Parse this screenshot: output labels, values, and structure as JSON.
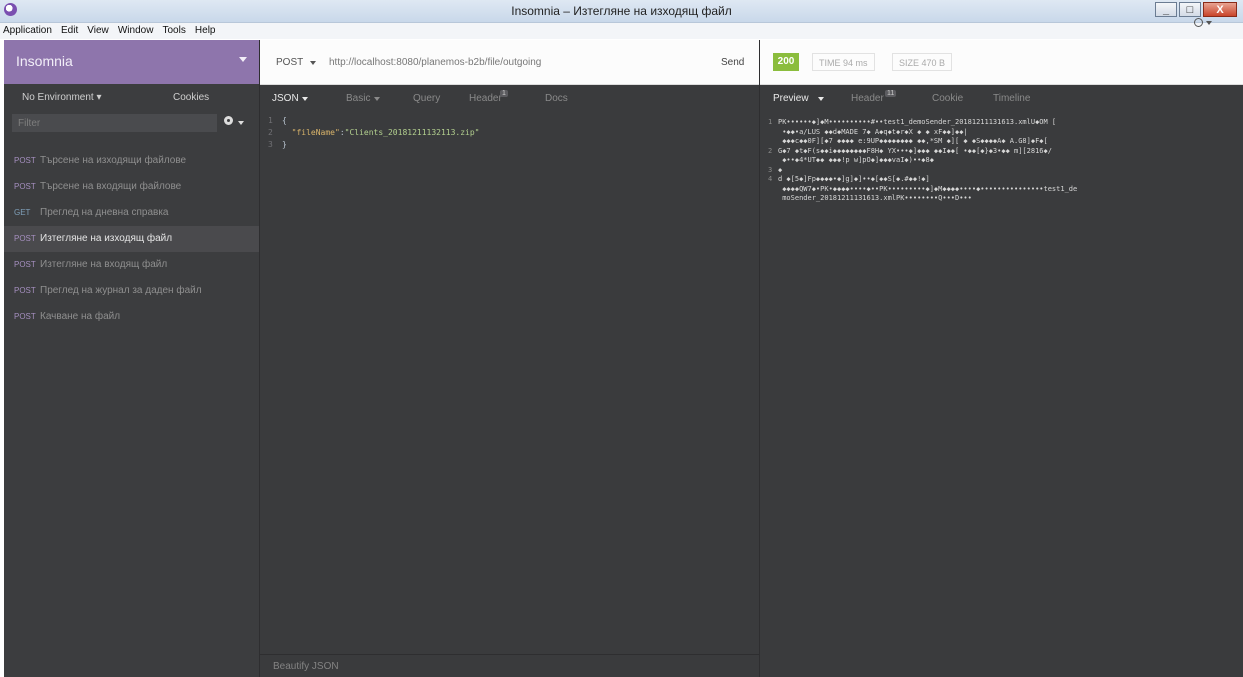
{
  "window": {
    "title": "Insomnia – Изтегляне на изходящ файл",
    "buttons": {
      "minimize": "_",
      "maximize": "□",
      "close": "X"
    }
  },
  "menu": [
    "Application",
    "Edit",
    "View",
    "Window",
    "Tools",
    "Help"
  ],
  "sidebar": {
    "workspace": "Insomnia",
    "environment": "No Environment",
    "cookies": "Cookies",
    "filter_placeholder": "Filter",
    "requests": [
      {
        "method": "POST",
        "label": "Търсене на изходящи файлове",
        "active": false
      },
      {
        "method": "POST",
        "label": "Търсене на входящи файлове",
        "active": false
      },
      {
        "method": "GET",
        "label": "Преглед на дневна справка",
        "active": false
      },
      {
        "method": "POST",
        "label": "Изтегляне на изходящ файл",
        "active": true
      },
      {
        "method": "POST",
        "label": "Изтегляне на входящ файл",
        "active": false
      },
      {
        "method": "POST",
        "label": "Преглед на журнал за даден файл",
        "active": false
      },
      {
        "method": "POST",
        "label": "Качване на файл",
        "active": false
      }
    ]
  },
  "request": {
    "method": "POST",
    "url": "http://localhost:8080/planemos-b2b/file/outgoing",
    "send": "Send",
    "tabs": {
      "body": "JSON",
      "auth": "Basic",
      "query": "Query",
      "header": "Header",
      "header_count": "1",
      "docs": "Docs"
    },
    "body_lines": [
      {
        "n": "1",
        "text": "{"
      },
      {
        "n": "2",
        "key": "\"fileName\"",
        "sep": ":",
        "value": "\"Clients_20181211132113.zip\""
      },
      {
        "n": "3",
        "text": "}"
      }
    ],
    "footer": "Beautify JSON"
  },
  "response": {
    "status": "200",
    "time_label": "TIME",
    "time_value": "94 ms",
    "size_label": "SIZE",
    "size_value": "470 B",
    "tabs": {
      "preview": "Preview",
      "header": "Header",
      "header_count": "11",
      "cookie": "Cookie",
      "timeline": "Timeline"
    },
    "preview_lines": [
      {
        "n": "1",
        "text": "PK••••••◆]◆M••••••••••#••test1_demoSender_20181211131613.xmlU◆OM ["
      },
      {
        "n": "",
        "text": " •◆◆•a/LUS ◆◆d◆MADE 7◆ A◆q◆t◆r◆X ◆ ◆ xF◆◆]◆◆|"
      },
      {
        "n": "",
        "text": " ◆◆◆c◆◆0F][◆7 ◆◆◆◆ e:9UP◆◆◆◆◆◆◆◆ ◆◆,*SM ◆][ ◆ ◆S◆◆◆◆A◆ A.G8]◆F◆["
      },
      {
        "n": "2",
        "text": "G◆7 ◆t◆F(s◆◆i◆◆◆◆◆◆◆◆F8H◆ YX•••◆]◆◆◆ ◆◆I◆◆[ •◆◆[◆}◆3•◆◆ m][2816◆/"
      },
      {
        "n": "",
        "text": " ◆••◆4*UT◆◆ ◆◆◆!p w]pO◆]◆◆◆vaI◆)••◆8◆"
      },
      {
        "n": "3",
        "text": "◆"
      },
      {
        "n": "4",
        "text": "d ◆[5◆]Fp◆◆◆◆•◆]g]◆]••◆[◆◆S[◆.#◆◆!◆]"
      },
      {
        "n": "",
        "text": " ◆◆◆◆QW7◆•PK•◆◆◆◆••••◆••PK•••••••••◆]◆M◆◆◆◆••••◆•••••••••••••••test1_de"
      },
      {
        "n": "",
        "text": " moSender_20181211131613.xmlPK••••••••Q•••D•••"
      }
    ]
  }
}
